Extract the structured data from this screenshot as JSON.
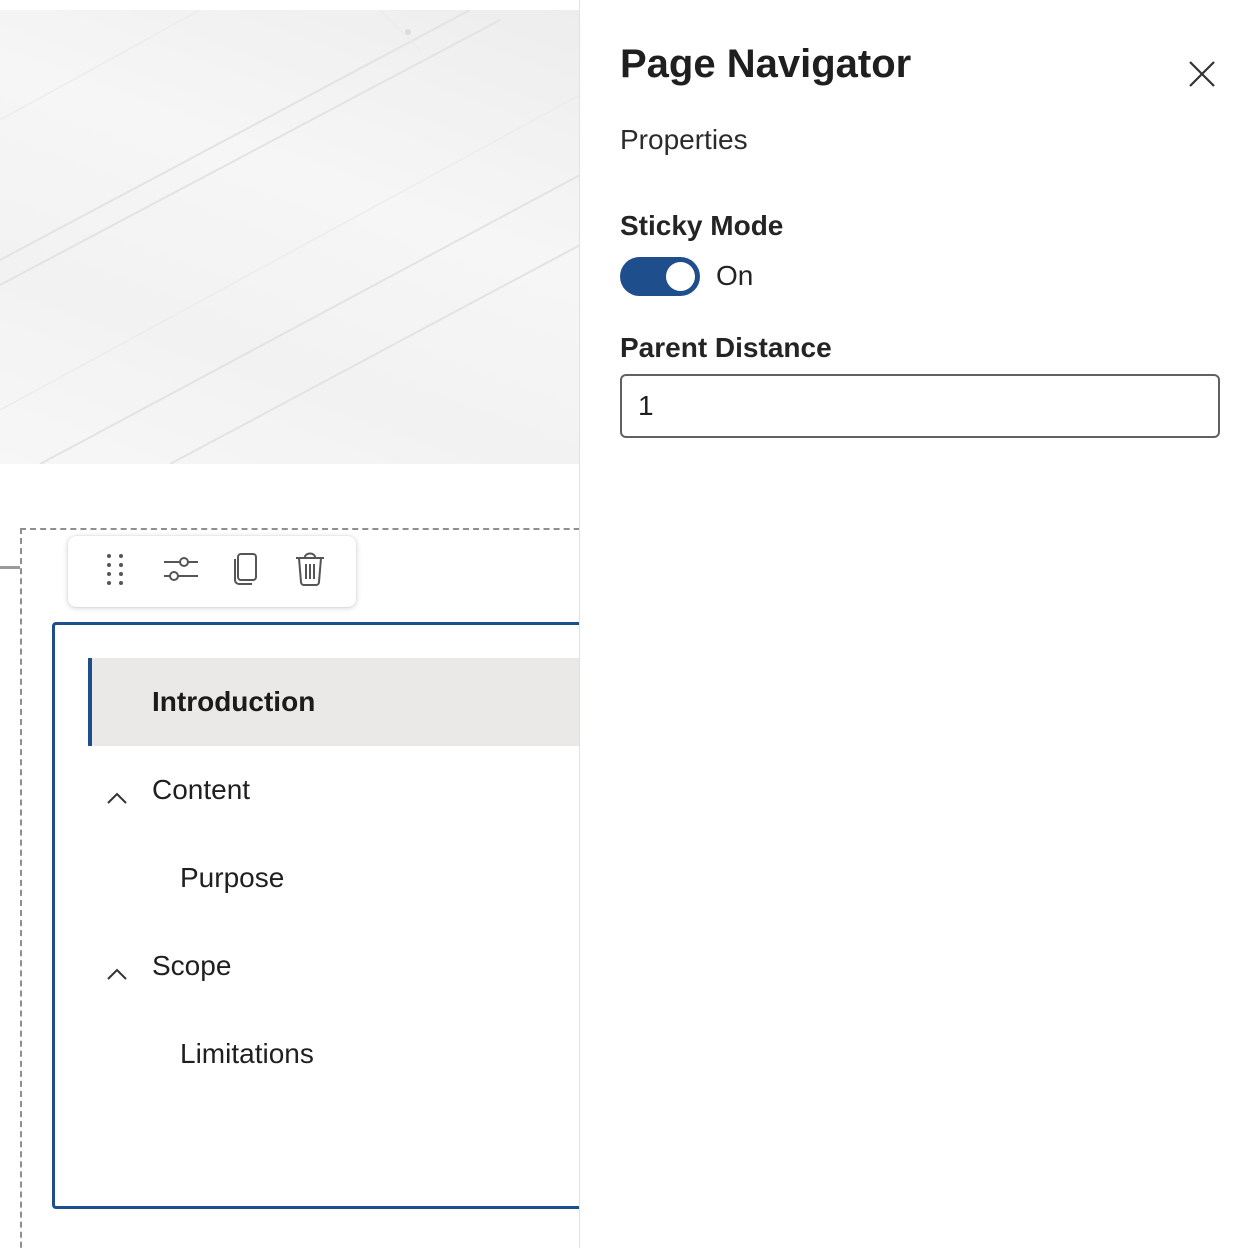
{
  "panel": {
    "title": "Page Navigator",
    "section": "Properties",
    "sticky_mode": {
      "label": "Sticky Mode",
      "state_text": "On",
      "checked": true
    },
    "parent_distance": {
      "label": "Parent Distance",
      "value": "1"
    },
    "close_icon": "close-icon"
  },
  "toolbar": {
    "icons": [
      "drag-handle-icon",
      "settings-sliders-icon",
      "duplicate-icon",
      "delete-icon"
    ]
  },
  "navigator": {
    "items": [
      {
        "label": "Introduction",
        "active": true
      },
      {
        "label": "Content",
        "collapsible": true
      },
      {
        "label": "Purpose"
      },
      {
        "label": "Scope",
        "collapsible": true
      },
      {
        "label": "Limitations"
      }
    ]
  },
  "colors": {
    "accent": "#1f4e8c",
    "active_item_bg": "#ebe9e8"
  }
}
